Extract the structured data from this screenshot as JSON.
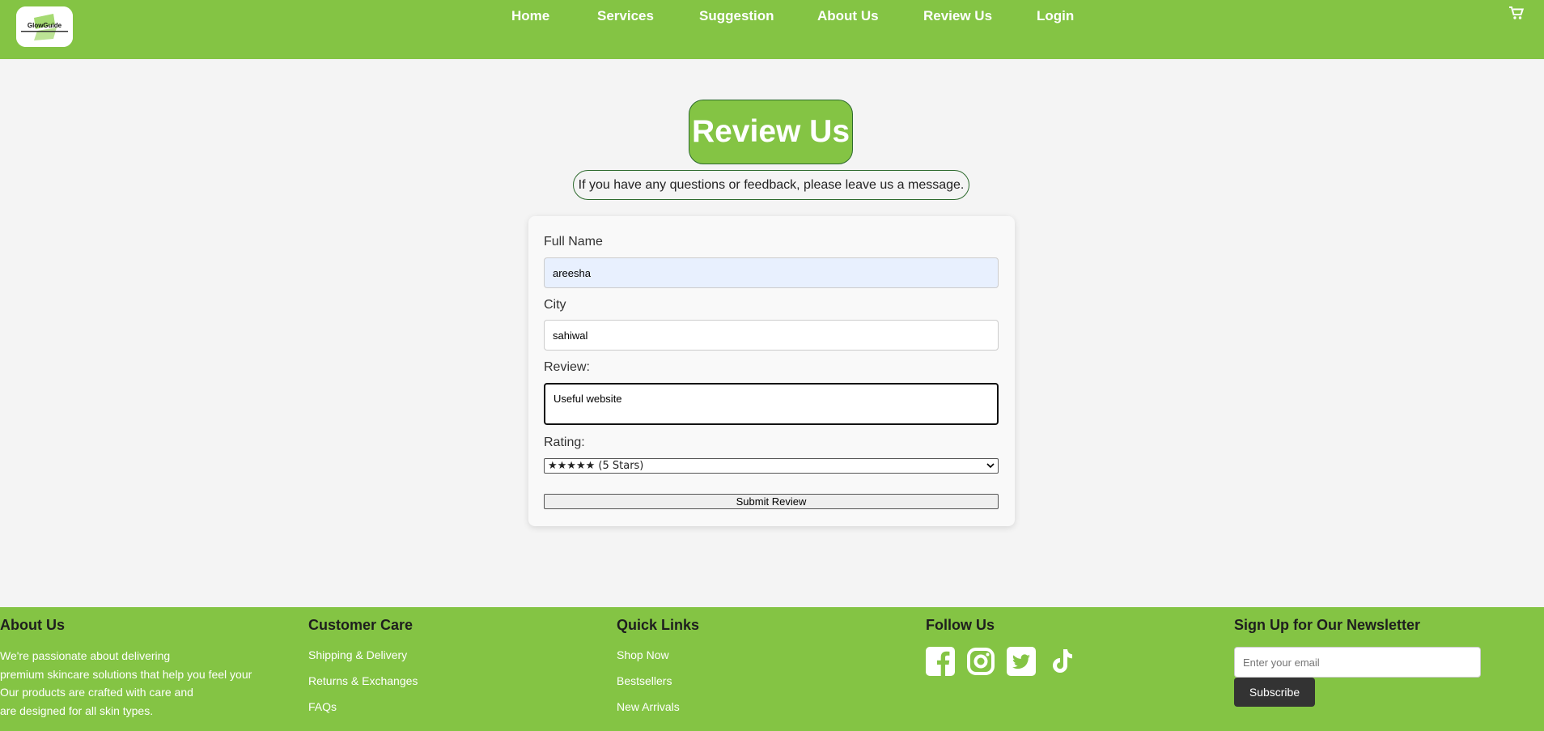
{
  "header": {
    "logo_text": "GlowGuide",
    "nav": [
      "Home",
      "Services",
      "Suggestion",
      "About Us",
      "Review Us",
      "Login"
    ]
  },
  "main": {
    "title": "Review Us",
    "subtitle": "If you have any questions or feedback, please leave us a message."
  },
  "form": {
    "full_name_label": "Full Name",
    "full_name_value": "areesha",
    "city_label": "City",
    "city_value": "sahiwal",
    "review_label": "Review:",
    "review_value": "Useful website",
    "rating_label": "Rating:",
    "rating_value": "★★★★★ (5 Stars)",
    "submit_label": "Submit Review"
  },
  "footer": {
    "about": {
      "title": "About Us",
      "lines": [
        "We're passionate about delivering",
        "premium skincare solutions that help you feel your",
        "Our products are crafted with care and",
        "are designed for all skin types."
      ]
    },
    "customer_care": {
      "title": "Customer Care",
      "links": [
        "Shipping & Delivery",
        "Returns & Exchanges",
        "FAQs"
      ]
    },
    "quick_links": {
      "title": "Quick Links",
      "links": [
        "Shop Now",
        "Bestsellers",
        "New Arrivals"
      ]
    },
    "follow": {
      "title": "Follow Us",
      "icons": [
        "facebook-icon",
        "instagram-icon",
        "twitter-icon",
        "tiktok-icon"
      ]
    },
    "newsletter": {
      "title": "Sign Up for Our Newsletter",
      "placeholder": "Enter your email",
      "button": "Subscribe"
    }
  },
  "colors": {
    "brand_green": "#84c444",
    "border_green": "#2d6a2d",
    "dark_button": "#333333"
  }
}
